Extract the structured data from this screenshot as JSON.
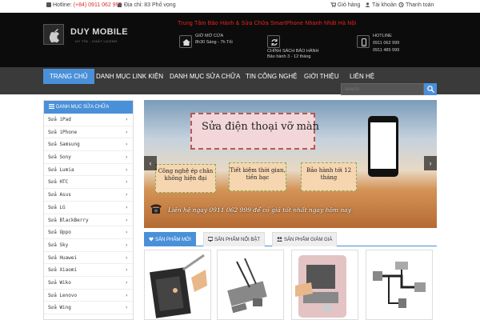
{
  "topbar": {
    "hotline_label": "Hotline:",
    "hotline_number": "(+84) 0911 062 999",
    "address": "Địa chỉ: 83 Phố vọng",
    "cart": "Giỏ hàng",
    "account": "Tài khoản",
    "checkout": "Thanh toán"
  },
  "header": {
    "brand": "DUY MOBILE",
    "brand_sub": "UY TÍN - CHẤT LƯỢNG",
    "tagline": "Trung Tâm Bảo Hành & Sửa Chữa SmartPhone Nhanh Nhất Hà Nội",
    "block1_title": "GIỜ MỞ CỬA",
    "block1_sub": "8h30 Sáng - 7h Tối",
    "block2_title": "CHÍNH SÁCH BẢO HÀNH",
    "block2_sub": "Bảo hành 3 - 12 tháng",
    "block3_title": "HOTLINE",
    "block3_line1": "0911 062 999",
    "block3_line2": "0911 485 999"
  },
  "nav": {
    "items": [
      "TRANG CHỦ",
      "DANH MỤC LINK KIỆN",
      "DANH MỤC SỬA CHỮA",
      "TIN CÔNG NGHỆ",
      "GIỚI THIỆU",
      "LIÊN HỆ"
    ],
    "search_placeholder": "search"
  },
  "sidebar": {
    "title": "DANH MỤC SỬA CHỮA",
    "items": [
      "Sửa iPad",
      "Sửa iPhone",
      "Sửa Samsung",
      "Sửa Sony",
      "Sửa Lumia",
      "Sửa HTC",
      "Sửa Asus",
      "Sửa LG",
      "Sửa BlackBerry",
      "Sửa Oppo",
      "Sửa Sky",
      "Sửa Huawei",
      "Sửa Xiaomi",
      "Sửa Wiko",
      "Sửa Lenovo",
      "Sửa Wing"
    ],
    "arrow": "›"
  },
  "banner": {
    "headline": "Sửa điện thoại vỡ màn",
    "card1": "Công nghệ ép chân không hiện đại",
    "card2": "Tiết kiệm thời gian, tiền bạc",
    "card3": "Bảo hành tới 12 tháng",
    "hotline_text": "Liên hệ ngay 0911 062 999 để có giá tốt nhất ngay hôm nay",
    "prev": "‹",
    "next": "›"
  },
  "tabs": {
    "items": [
      "SẢN PHẨM MỚI",
      "SẢN PHẨM NỔI BẬT",
      "SẢN PHẨM GIẢM GIÁ"
    ]
  },
  "colors": {
    "accent": "#4a90d9",
    "header_bg": "#0c0c0c",
    "nav_bg": "#3a3a3a",
    "tagline": "#e22222"
  }
}
